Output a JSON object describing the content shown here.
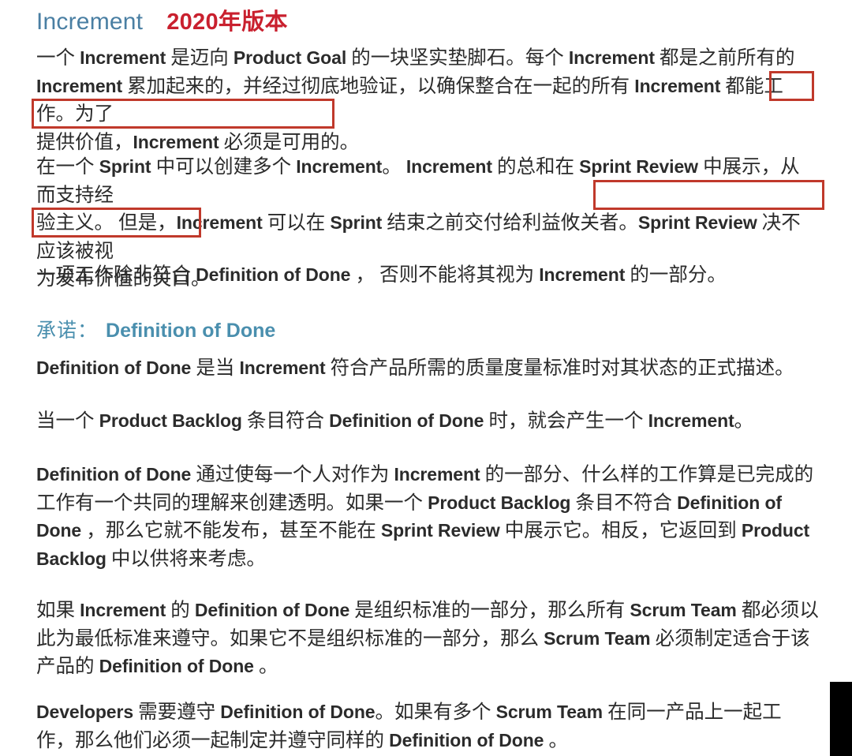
{
  "document": {
    "title_main": "Increment",
    "title_version": "2020年版本",
    "title_color": "#4a7fa3",
    "version_color": "#c9202e",
    "annotation_color": "#c0392b",
    "body_color": "#2b2b2b"
  },
  "paragraphs": {
    "p1": "一个 Increment 是迈向 Product Goal 的一块坚实垫脚石。每个 Increment 都是之前所有的 Increment 累加起来的，并经过彻底地验证，以确保整合在一起的所有 Increment 都能工作。为了提供价值，Increment 必须是可用的。",
    "p1_line1": "一个 Increment 是迈向 Product Goal 的一块坚实垫脚石。每个 Increment 都是之前所有的",
    "p1_line2": "Increment 累加起来的，并经过彻底地验证，以确保整合在一起的所有 Increment 都能工作。为了",
    "p1_line3": "提供价值，Increment 必须是可用的。",
    "p2": "在一个 Sprint 中可以创建多个 Increment。 Increment 的总和在 Sprint Review 中展示，从而支持经验主义。 但是，Increment 可以在 Sprint 结束之前交付给利益攸关者。Sprint Review 决不应该被视为发布价值的关口。",
    "p2_line1": "在一个 Sprint 中可以创建多个 Increment。 Increment 的总和在 Sprint Review 中展示，从而支持经",
    "p2_line2": "验主义。 但是，Increment 可以在 Sprint 结束之前交付给利益攸关者。Sprint Review 决不应该被视",
    "p2_line3": "为发布价值的关口。",
    "p3": "一项工作除非符合 Definition of Done ， 否则不能将其视为 Increment 的一部分。",
    "p4": "Definition of Done 是当 Increment 符合产品所需的质量度量标准时对其状态的正式描述。",
    "p5": "当一个 Product Backlog 条目符合 Definition of Done 时，就会产生一个 Increment。",
    "p6": "Definition of Done 通过使每一个人对作为 Increment 的一部分、什么样的工作算是已完成的工作有一个共同的理解来创建透明。如果一个 Product Backlog 条目不符合 Definition of Done ，那么它就不能发布，甚至不能在 Sprint Review 中展示它。相反，它返回到 Product Backlog 中以供将来考虑。",
    "p7": "如果 Increment 的 Definition of Done 是组织标准的一部分，那么所有 Scrum Team 都必须以此为最低标准来遵守。如果它不是组织标准的一部分，那么 Scrum Team 必须制定适合于该产品的 Definition of Done 。",
    "p8": "Developers 需要遵守 Definition of Done。如果有多个 Scrum Team 在同一产品上一起工作，那么他们必须一起制定并遵守同样的 Definition of Done 。"
  },
  "headings": {
    "commitment_cn": "承诺：",
    "commitment_en": "Definition of Done"
  },
  "annotations": [
    {
      "id": "box-weile",
      "text": "为了"
    },
    {
      "id": "box-tigong-jiazhi",
      "text": "提供价值，Increment 必须是可用的。"
    },
    {
      "id": "box-sprint-review",
      "text": "Sprint Review 决不应该被视"
    },
    {
      "id": "box-fabu-jiazhi",
      "text": "为发布价值的关口。"
    }
  ]
}
